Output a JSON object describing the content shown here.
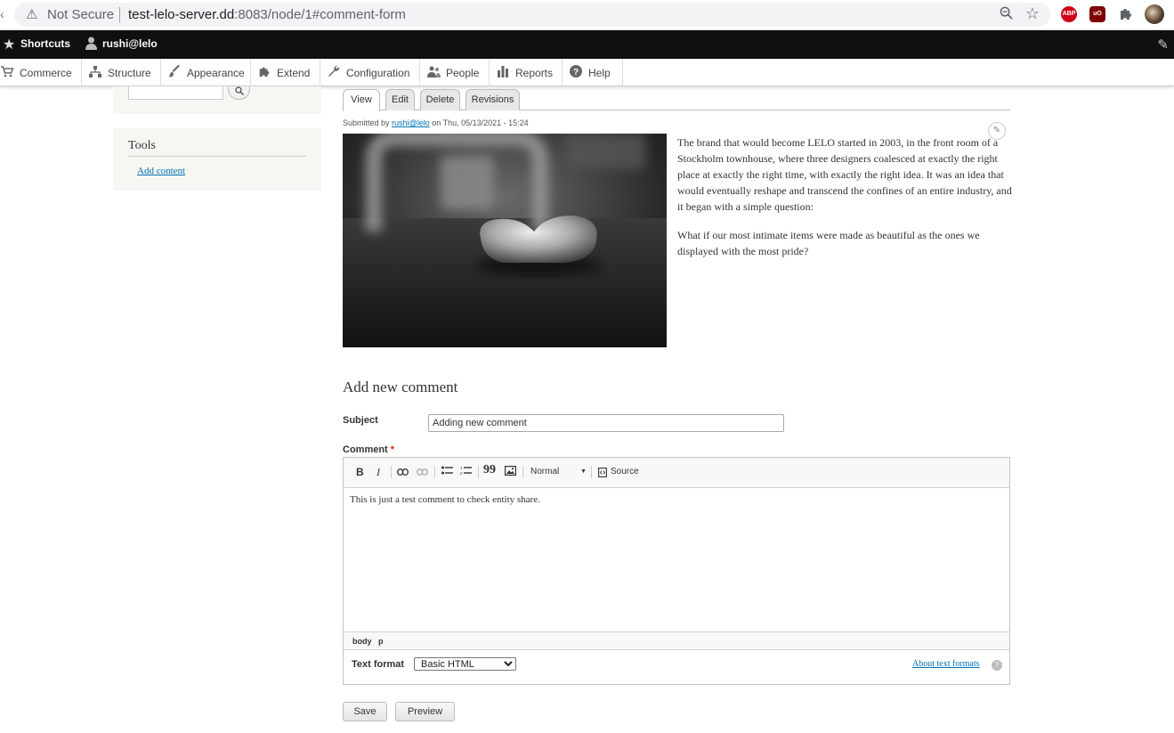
{
  "browser": {
    "security_label": "Not Secure",
    "url_host": "test-lelo-server.dd",
    "url_path": ":8083/node/1#comment-form",
    "extensions": {
      "abp": "ABP",
      "ubo": "uO"
    }
  },
  "toolbar": {
    "shortcuts": "Shortcuts",
    "user": "rushi@lelo"
  },
  "admin_tray": [
    {
      "label": "Commerce",
      "icon": "cart-icon"
    },
    {
      "label": "Structure",
      "icon": "sitemap-icon"
    },
    {
      "label": "Appearance",
      "icon": "brush-icon"
    },
    {
      "label": "Extend",
      "icon": "puzzle-icon"
    },
    {
      "label": "Configuration",
      "icon": "wrench-icon"
    },
    {
      "label": "People",
      "icon": "people-icon"
    },
    {
      "label": "Reports",
      "icon": "bar-chart-icon"
    },
    {
      "label": "Help",
      "icon": "help-icon"
    }
  ],
  "sidebar": {
    "tools_title": "Tools",
    "add_content": "Add content"
  },
  "tabs": [
    "View",
    "Edit",
    "Delete",
    "Revisions"
  ],
  "active_tab": "View",
  "node": {
    "submitted_prefix": "Submitted by",
    "author": "rushi@lelo",
    "submitted_suffix": "on Thu, 05/13/2021 - 15:24",
    "paragraph1": "The brand that would become LELO started in 2003, in the front room of a Stockholm townhouse, where three designers coalesced at exactly the right place at exactly the right time, with exactly the right idea. It was an idea that would eventually reshape and transcend the confines of an entire industry, and it began with a simple question:",
    "paragraph2": "What if our most intimate items were made as beautiful as the ones we displayed with the most pride?"
  },
  "comment_form": {
    "heading": "Add new comment",
    "subject_label": "Subject",
    "subject_value": "Adding new comment",
    "comment_label": "Comment",
    "required_mark": "*",
    "editor_toolbar": {
      "bold": "B",
      "italic": "I",
      "quote": "99",
      "format": "Normal",
      "source": "Source"
    },
    "comment_text": "This is just a test comment to check entity share.",
    "path": [
      "body",
      "p"
    ],
    "text_format_label": "Text format",
    "text_format_value": "Basic HTML",
    "about_text_formats": "About text formats",
    "help_mark": "?"
  },
  "buttons": {
    "save": "Save",
    "preview": "Preview"
  }
}
